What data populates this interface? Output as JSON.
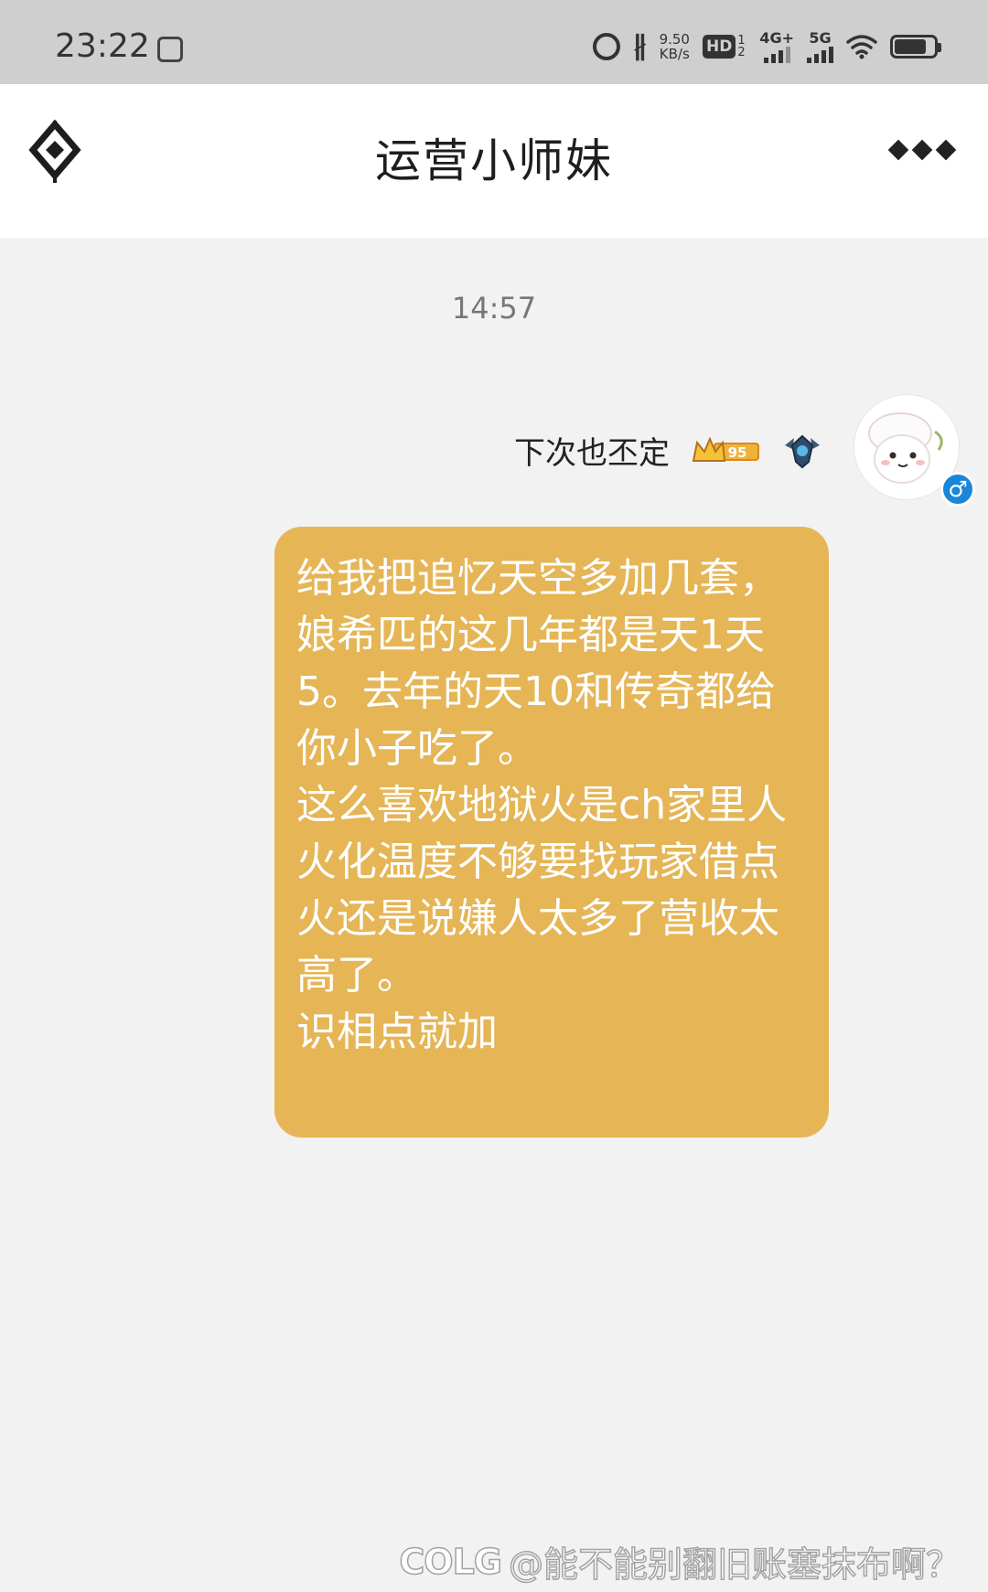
{
  "status_bar": {
    "time": "23:22",
    "net_speed_value": "9.50",
    "net_speed_unit": "KB/s",
    "hd_label": "HD",
    "hd_sub": "1 2",
    "signal_1": "4G+",
    "signal_2": "5G",
    "icons": [
      "app-notification-icon",
      "alarm-icon",
      "bluetooth-icon",
      "hd-icon",
      "signal-4g-icon",
      "signal-5g-icon",
      "wifi-icon",
      "battery-icon"
    ],
    "battery_level": 0.8
  },
  "header": {
    "title": "运营小师妹",
    "back_icon": "back-diamond-icon",
    "more_icon": "more-icon"
  },
  "chat": {
    "timestamp": "14:57",
    "sender": {
      "name": "下次也丕定",
      "level_badge": "95",
      "gender": "♂",
      "icons": [
        "level-crown-badge",
        "rank-emblem-icon",
        "avatar"
      ]
    },
    "message": "给我把追忆天空多加几套，娘希匹的这几年都是天1天5。去年的天10和传奇都给你小子吃了。\n这么喜欢地狱火是ch家里人火化温度不够要找玩家借点火还是说嫌人太多了营收太高了。\n识相点就加"
  },
  "watermark": {
    "logo": "COLG",
    "text": "@能不能别翻旧账塞抹布啊？"
  },
  "colors": {
    "bubble": "#e5b556",
    "status_bar": "#cfcfcf",
    "chat_bg": "#f2f2f2",
    "gender_badge": "#1a86d8"
  }
}
